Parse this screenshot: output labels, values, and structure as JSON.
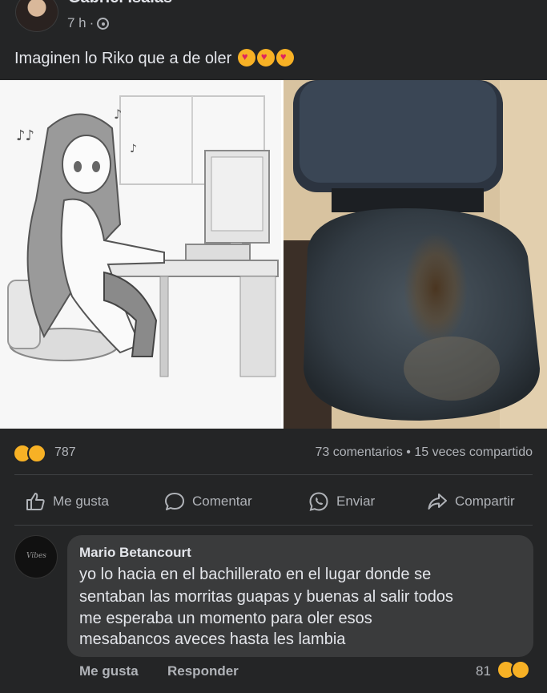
{
  "post": {
    "author": "Gabriel Isaías",
    "time": "7 h",
    "separator": "·",
    "text": "Imaginen lo Riko que a de oler",
    "emoji_icons": [
      "smiling-face-with-hearts-icon",
      "smiling-face-with-hearts-icon",
      "smiling-face-with-hearts-icon"
    ]
  },
  "stats": {
    "reaction_icons": [
      "haha-icon",
      "sad-icon"
    ],
    "reaction_count": "787",
    "comments": "73 comentarios",
    "dot": "•",
    "shares": "15 veces compartido"
  },
  "actions": {
    "like": "Me gusta",
    "comment": "Comentar",
    "send": "Enviar",
    "share": "Compartir"
  },
  "comment": {
    "author": "Mario Betancourt",
    "avatar_text": "Vibes",
    "lines": [
      "yo lo hacia en el bachillerato en el lugar donde se",
      "sentaban las morritas guapas y buenas al salir todos",
      "me esperaba un momento para oler esos",
      "mesabancos aveces hasta les lambia"
    ],
    "like": "Me gusta",
    "reply": "Responder",
    "reaction_count": "81",
    "reaction_icons": [
      "haha-icon",
      "sad-icon"
    ]
  },
  "colors": {
    "background": "#242526",
    "bubble": "#3a3b3c",
    "text_primary": "#e4e6eb",
    "text_secondary": "#b0b3b8",
    "reaction_yellow": "#f7b125"
  }
}
